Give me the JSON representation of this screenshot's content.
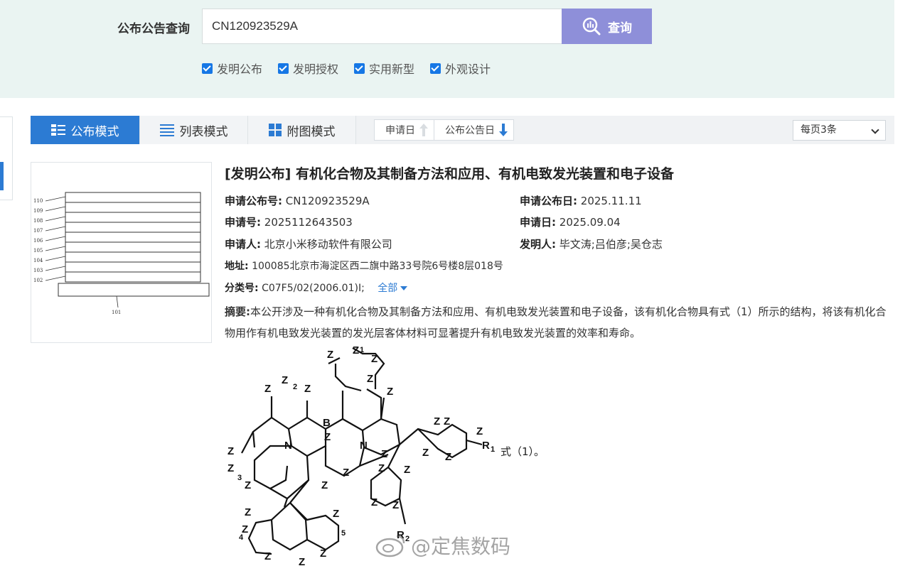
{
  "search": {
    "label": "公布公告查询",
    "value": "CN120923529A",
    "button": "查询"
  },
  "filters": [
    {
      "label": "发明公布",
      "checked": true
    },
    {
      "label": "发明授权",
      "checked": true
    },
    {
      "label": "实用新型",
      "checked": true
    },
    {
      "label": "外观设计",
      "checked": true
    }
  ],
  "toolbar": {
    "modes": [
      "公布模式",
      "列表模式",
      "附图模式"
    ],
    "active_mode": "公布模式",
    "sort": [
      "申请日",
      "公布公告日"
    ],
    "per_page": "每页3条"
  },
  "result": {
    "title": "[发明公布] 有机化合物及其制备方法和应用、有机电致发光装置和电子设备",
    "pub_no_label": "申请公布号:",
    "pub_no": "CN120923529A",
    "pub_date_label": "申请公布日:",
    "pub_date": "2025.11.11",
    "app_no_label": "申请号:",
    "app_no": "2025112643503",
    "app_date_label": "申请日:",
    "app_date": "2025.09.04",
    "applicant_label": "申请人:",
    "applicant": "北京小米移动软件有限公司",
    "inventor_label": "发明人:",
    "inventors": "毕文涛;吕伯彦;吴仓志",
    "address_label": "地址:",
    "address": "100085北京市海淀区西二旗中路33号院6号楼8层018号",
    "class_label": "分类号:",
    "class": "C07F5/02(2006.01)I;",
    "class_all": "全部",
    "abstract_label": "摘要:",
    "abstract": "本公开涉及一种有机化合物及其制备方法和应用、有机电致发光装置和电子设备，该有机化合物具有式（1）所示的结构，将该有机化合物用作有机电致发光装置的发光层客体材料可显著提升有机电致发光装置的效率和寿命。",
    "formula_label": "式（1）。"
  },
  "thumbnail": {
    "layers": [
      "110",
      "109",
      "108",
      "107",
      "106",
      "105",
      "104",
      "103",
      "102"
    ],
    "substrate": "101"
  },
  "formula": {
    "z_labels": [
      "Z",
      "Z",
      "Z",
      "Z",
      "Z",
      "Z",
      "Z",
      "Z",
      "Z",
      "Z",
      "Z",
      "Z",
      "Z",
      "Z",
      "Z",
      "Z",
      "Z",
      "Z",
      "Z",
      "Z",
      "Z",
      "Z",
      "Z",
      "Z",
      "Z",
      "Z"
    ],
    "subscripts": [
      "Z1",
      "Z2",
      "Z3",
      "Z4",
      "Z5",
      "R1",
      "R2",
      "B",
      "N",
      "N"
    ]
  },
  "watermark": "@定焦数码"
}
